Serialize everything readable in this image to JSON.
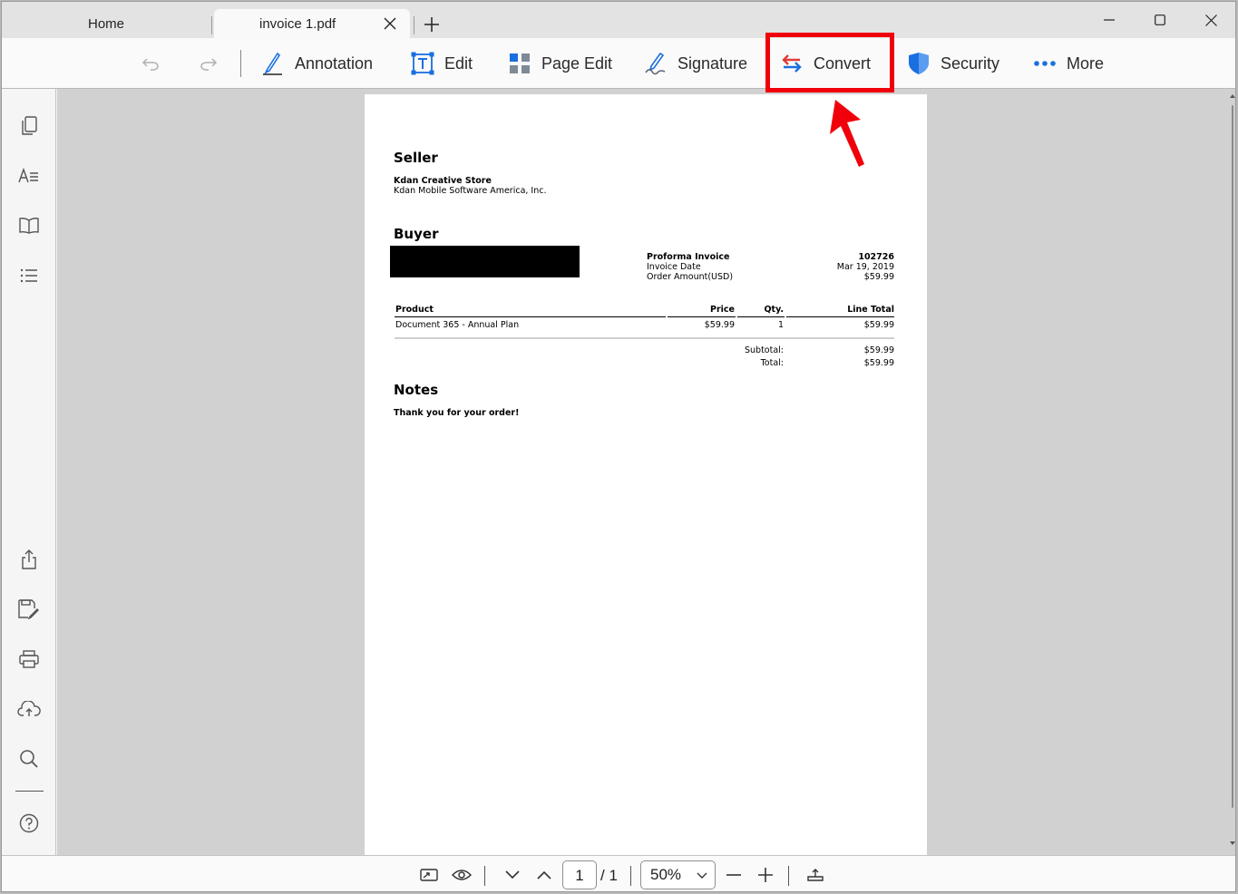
{
  "tabs": {
    "home": "Home",
    "active": "invoice 1.pdf"
  },
  "toolbar": {
    "annotation": "Annotation",
    "edit": "Edit",
    "page_edit": "Page Edit",
    "signature": "Signature",
    "convert": "Convert",
    "security": "Security",
    "more": "More"
  },
  "colors": {
    "accent_blue": "#1a6fe0",
    "highlight_red": "#f0000b"
  },
  "document": {
    "seller_heading": "Seller",
    "seller_name": "Kdan Creative Store",
    "seller_company": "Kdan Mobile Software America, Inc.",
    "buyer_heading": "Buyer",
    "invoice_title": "Proforma Invoice",
    "invoice_number": "102726",
    "invoice_date_label": "Invoice Date",
    "invoice_date": "Mar 19, 2019",
    "order_amount_label": "Order Amount(USD)",
    "order_amount": "$59.99",
    "table_headers": {
      "product": "Product",
      "price": "Price",
      "qty": "Qty.",
      "line_total": "Line Total"
    },
    "items": [
      {
        "product": "Document 365 - Annual Plan",
        "price": "$59.99",
        "qty": "1",
        "line_total": "$59.99"
      }
    ],
    "subtotal_label": "Subtotal:",
    "subtotal": "$59.99",
    "total_label": "Total:",
    "total": "$59.99",
    "notes_heading": "Notes",
    "notes_text": "Thank you for your order!"
  },
  "bottombar": {
    "page_current": "1",
    "page_total": "/ 1",
    "zoom": "50%"
  }
}
